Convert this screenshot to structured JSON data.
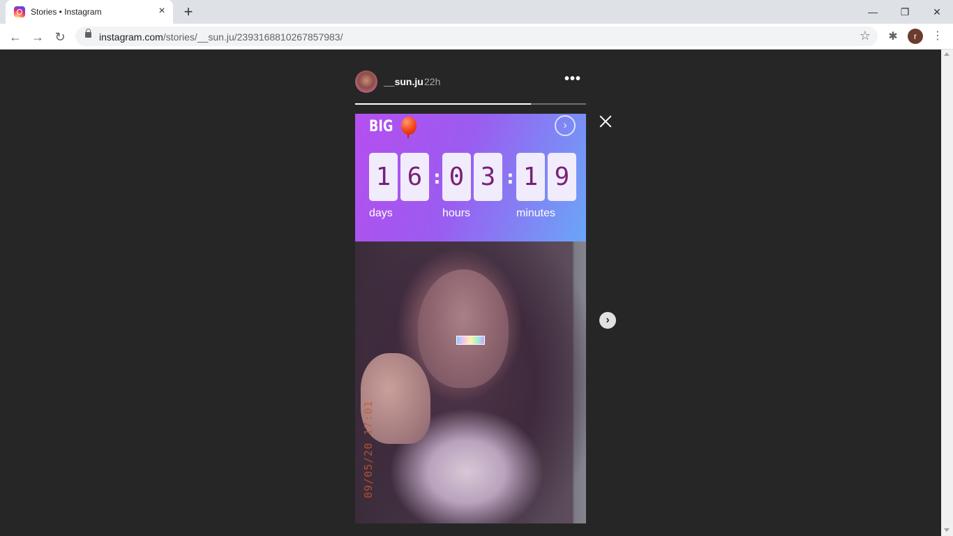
{
  "browser": {
    "tab_title": "Stories • Instagram",
    "tab_close": "×",
    "new_tab": "+",
    "url_host": "instagram.com",
    "url_path": "/stories/__sun.ju/2393168810267857983/",
    "profile_initial": "r",
    "back_icon": "←",
    "forward_icon": "→",
    "reload_icon": "↻",
    "star_icon": "☆",
    "extensions_icon": "✱",
    "menu_icon": "⋮",
    "minimize_icon": "—",
    "restore_icon": "❐",
    "close_icon": "✕"
  },
  "story": {
    "username": "__sun.ju",
    "time_ago": "22h",
    "more_label": "•••",
    "progress": 0.76,
    "countdown": {
      "title": "BIG",
      "arrow": "›",
      "digits": [
        "1",
        "6",
        "0",
        "3",
        "1",
        "9"
      ],
      "separator": ":",
      "labels": [
        "days",
        "hours",
        "minutes"
      ]
    },
    "photo_datestamp": "09/05/20 17:01",
    "next_label": "›"
  },
  "colors": {
    "page_background": "#262626",
    "countdown_gradient_start": "#b54ef0",
    "countdown_gradient_end": "#6aa6f8",
    "digit_color": "#7a1f78"
  }
}
